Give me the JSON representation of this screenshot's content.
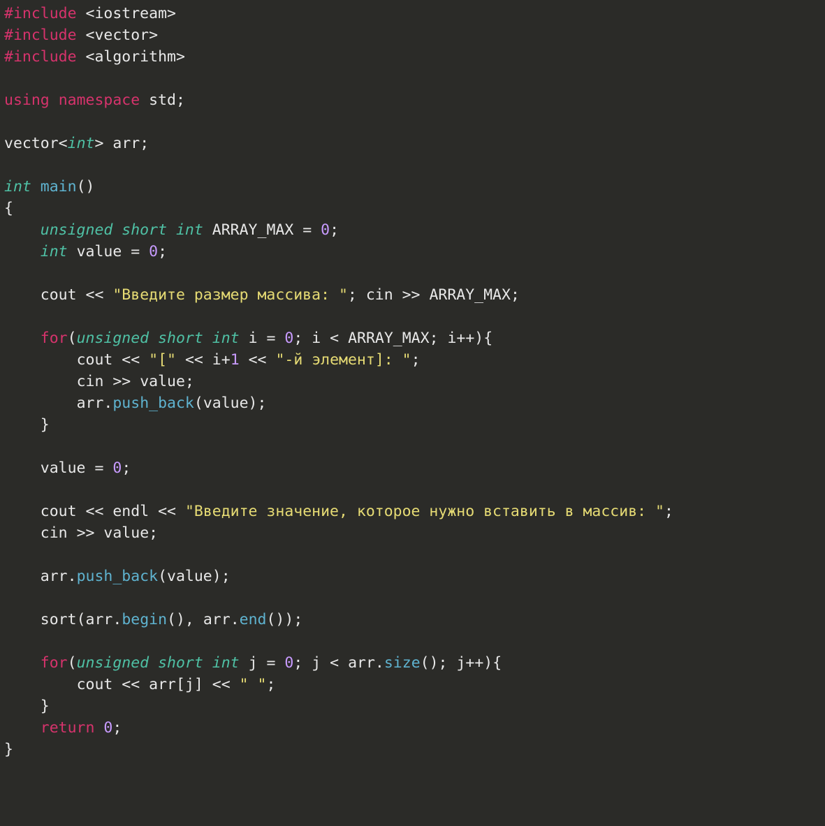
{
  "code": {
    "line1_pp": "#include",
    "line1_hdr": "<iostream>",
    "line2_pp": "#include",
    "line2_hdr": "<vector>",
    "line3_pp": "#include",
    "line3_hdr": "<algorithm>",
    "line5_using": "using",
    "line5_namespace": "namespace",
    "line5_std": "std",
    "line7_vector": "vector",
    "line7_lt": "<",
    "line7_int": "int",
    "line7_gt": ">",
    "line7_arr": "arr",
    "line9_int": "int",
    "line9_main": "main",
    "line11_unsigned": "unsigned",
    "line11_short": "short",
    "line11_int": "int",
    "line11_name": "ARRAY_MAX",
    "line11_val": "0",
    "line12_int": "int",
    "line12_name": "value",
    "line12_val": "0",
    "line14_cout": "cout",
    "line14_str": "\"Введите размер массива: \"",
    "line14_cin": "cin",
    "line14_arrmax": "ARRAY_MAX",
    "line16_for": "for",
    "line16_unsigned": "unsigned",
    "line16_short": "short",
    "line16_int": "int",
    "line16_i": "i",
    "line16_zero": "0",
    "line16_arrmax": "ARRAY_MAX",
    "line17_cout": "cout",
    "line17_s1": "\"[\"",
    "line17_i": "i",
    "line17_one": "1",
    "line17_s2": "\"-й элемент]: \"",
    "line18_cin": "cin",
    "line18_value": "value",
    "line19_arr": "arr",
    "line19_push": "push_back",
    "line19_value": "value",
    "line22_value": "value",
    "line22_zero": "0",
    "line24_cout": "cout",
    "line24_endl": "endl",
    "line24_str": "\"Введите значение, которое нужно вставить в массив: \"",
    "line25_cin": "cin",
    "line25_value": "value",
    "line27_arr": "arr",
    "line27_push": "push_back",
    "line27_value": "value",
    "line29_sort": "sort",
    "line29_arr1": "arr",
    "line29_begin": "begin",
    "line29_arr2": "arr",
    "line29_end": "end",
    "line31_for": "for",
    "line31_unsigned": "unsigned",
    "line31_short": "short",
    "line31_int": "int",
    "line31_j": "j",
    "line31_zero": "0",
    "line31_arr": "arr",
    "line31_size": "size",
    "line32_cout": "cout",
    "line32_arr": "arr",
    "line32_j": "j",
    "line32_sp": "\" \"",
    "line34_return": "return",
    "line34_zero": "0"
  }
}
